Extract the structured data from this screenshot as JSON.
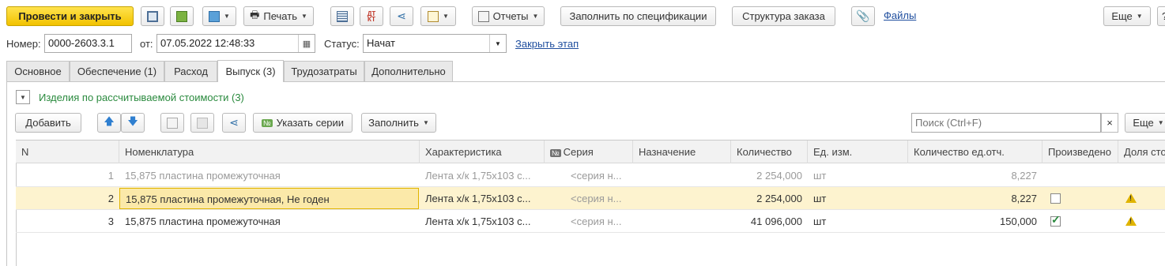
{
  "toolbar": {
    "post_close": "Провести и закрыть",
    "print": "Печать",
    "reports": "Отчеты",
    "fill_spec": "Заполнить по спецификации",
    "order_structure": "Структура заказа",
    "files": "Файлы",
    "more": "Еще",
    "help": "?"
  },
  "header": {
    "number_label": "Номер:",
    "number_value": "0000-2603.3.1",
    "date_label": "от:",
    "date_value": "07.05.2022 12:48:33",
    "status_label": "Статус:",
    "status_value": "Начат",
    "close_stage": "Закрыть этап"
  },
  "tabs": [
    "Основное",
    "Обеспечение (1)",
    "Расход",
    "Выпуск (3)",
    "Трудозатраты",
    "Дополнительно"
  ],
  "group": {
    "title": "Изделия по рассчитываемой стоимости (3)"
  },
  "table_toolbar": {
    "add": "Добавить",
    "series": "Указать серии",
    "fill": "Заполнить",
    "search_placeholder": "Поиск (Ctrl+F)",
    "clear": "×",
    "more": "Еще"
  },
  "table": {
    "columns": [
      "N",
      "Номенклатура",
      "Характеристика",
      "Серия",
      "Назначение",
      "Количество",
      "Ед. изм.",
      "Количество ед.отч.",
      "Произведено",
      "Доля сто"
    ],
    "serial_badge": "№",
    "rows": [
      {
        "n": "1",
        "name": "15,875 пластина промежуточная",
        "char": "Лента х/к 1,75х103 с...",
        "series": "<серия н...",
        "qty": "2 254,000",
        "unit": "шт",
        "qty_rep": "8,227"
      },
      {
        "n": "2",
        "name": "15,875 пластина промежуточная, Не годен",
        "char": "Лента х/к 1,75х103 с...",
        "series": "<серия н...",
        "qty": "2 254,000",
        "unit": "шт",
        "qty_rep": "8,227"
      },
      {
        "n": "3",
        "name": "15,875 пластина промежуточная",
        "char": "Лента х/к 1,75х103 с...",
        "series": "<серия н...",
        "qty": "41 096,000",
        "unit": "шт",
        "qty_rep": "150,000"
      }
    ]
  },
  "colors": {
    "accent": "#f5c800",
    "selected_row": "#fdf3cf",
    "link": "#1f4e9e",
    "group_title": "#2a8a3e"
  }
}
